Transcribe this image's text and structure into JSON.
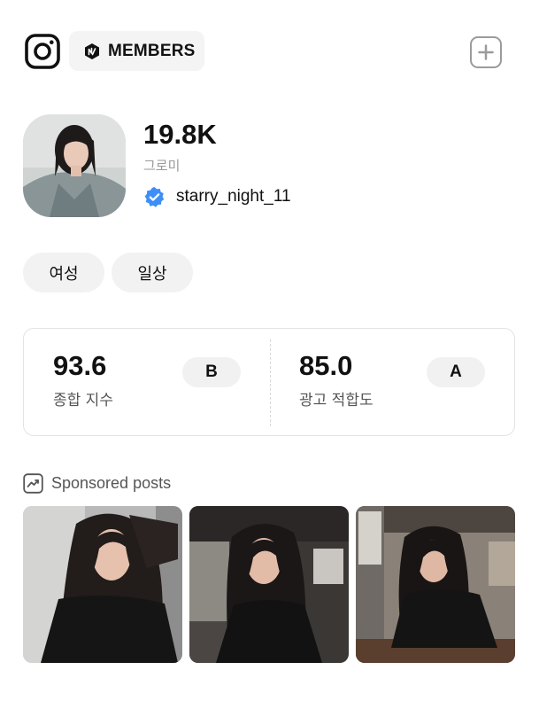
{
  "header": {
    "logo_icon": "instagram-icon",
    "badge_icon": "members-hexagon-icon",
    "badge_label": "MEMBERS",
    "add_icon": "plus-square-icon"
  },
  "profile": {
    "followers": "19.8K",
    "category": "그로미",
    "verified_icon": "verified-check-icon",
    "handle": "starry_night_11"
  },
  "tags": [
    "여성",
    "일상"
  ],
  "scores": [
    {
      "value": "93.6",
      "label": "종합 지수",
      "grade": "B"
    },
    {
      "value": "85.0",
      "label": "광고 적합도",
      "grade": "A"
    }
  ],
  "sponsored": {
    "icon": "trend-chart-icon",
    "title": "Sponsored posts",
    "post_count": 3
  },
  "colors": {
    "verified_blue": "#3e8ef7",
    "badge_bg": "#f4f4f4",
    "tag_bg": "#f2f2f2",
    "muted_text": "#9a9a9a"
  }
}
